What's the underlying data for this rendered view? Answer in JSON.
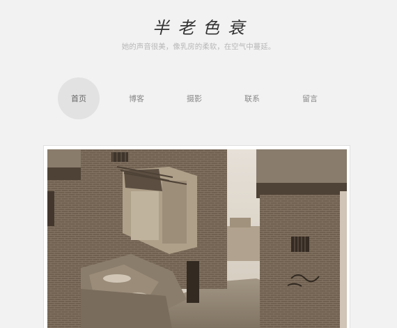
{
  "header": {
    "title": "半老色衰",
    "subtitle": "她的声音很美，像乳房的柔软，在空气中蔓延。"
  },
  "nav": {
    "items": [
      {
        "label": "首页",
        "active": true
      },
      {
        "label": "博客",
        "active": false
      },
      {
        "label": "摄影",
        "active": false
      },
      {
        "label": "联系",
        "active": false
      },
      {
        "label": "留言",
        "active": false
      }
    ]
  },
  "colors": {
    "background": "#f2f2f2",
    "active_nav": "#e2e2e2",
    "subtitle": "#b8b8b8"
  },
  "photo": {
    "subject": "sepia-photo-old-alley"
  }
}
